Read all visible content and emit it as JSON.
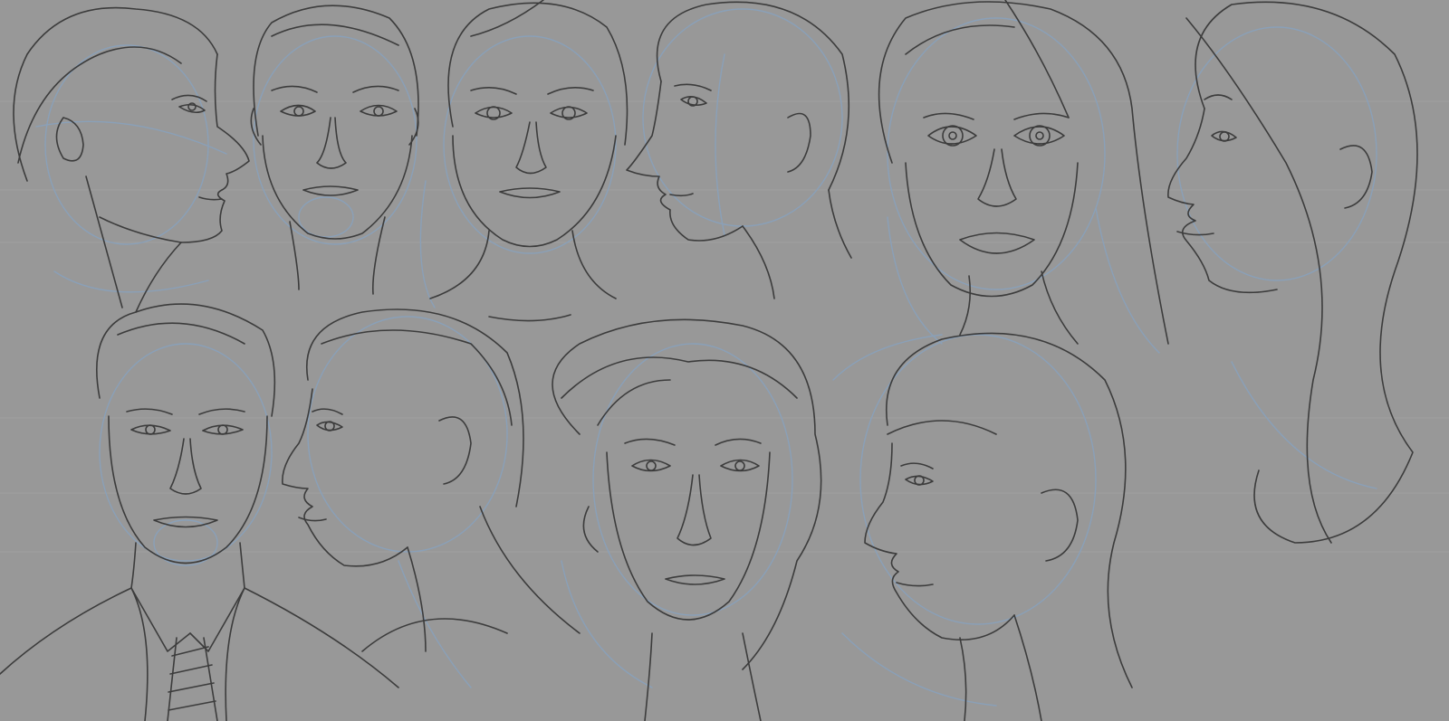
{
  "canvas": {
    "background": "#989898",
    "line_dark": "#3c3c3c",
    "line_blue": "#8aa0b8",
    "guide_line": "#a6a6a6"
  },
  "sketches": [
    {
      "id": "head-1",
      "view": "profile-right",
      "hair": "tied"
    },
    {
      "id": "head-2",
      "view": "front",
      "hair": "short"
    },
    {
      "id": "head-3",
      "view": "front",
      "hair": "long"
    },
    {
      "id": "head-4",
      "view": "profile-left",
      "hair": "bald"
    },
    {
      "id": "head-5",
      "view": "front",
      "hair": "long"
    },
    {
      "id": "head-6",
      "view": "profile-left",
      "hair": "long"
    },
    {
      "id": "head-7",
      "view": "front",
      "hair": "short",
      "attire": "suit-and-tie"
    },
    {
      "id": "head-8",
      "view": "profile-left",
      "hair": "short"
    },
    {
      "id": "head-9",
      "view": "front",
      "hair": "updo"
    },
    {
      "id": "head-10",
      "view": "profile-left",
      "hair": "short"
    }
  ]
}
